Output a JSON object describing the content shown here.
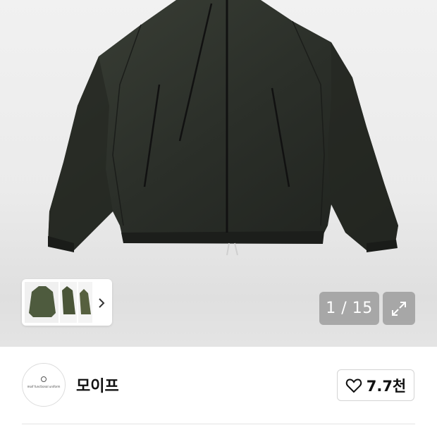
{
  "gallery": {
    "main_image_alt": "",
    "counter": "1 / 15",
    "thumbnail_count_visible": 3
  },
  "shop": {
    "name": "모이프",
    "logo_text": "moif functional uniform",
    "likes_label": "7.7천"
  },
  "colors": {
    "jacket": "#2e322b",
    "hero_background": "#ebebeb",
    "overlay_button": "#8a8a8a",
    "divider": "#e3e3e3"
  },
  "icons": {
    "thumbnail_next": "chevron-right-icon",
    "expand": "expand-icon",
    "like": "heart-outline-icon"
  }
}
